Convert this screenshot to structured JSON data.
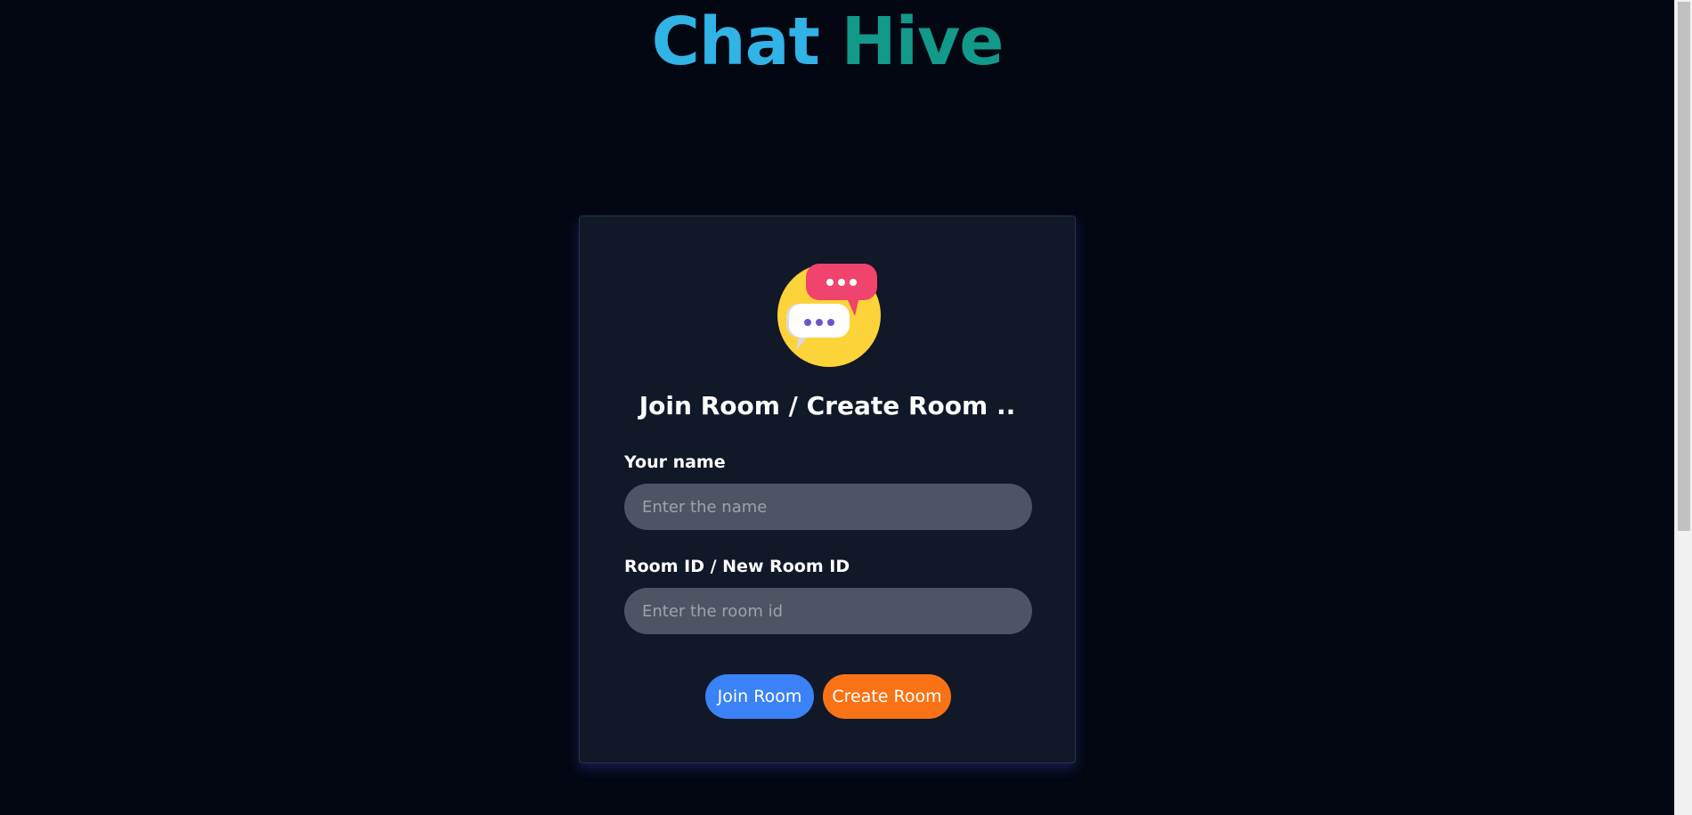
{
  "header": {
    "title_part1": "Chat",
    "title_part2": "Hive"
  },
  "card": {
    "logo_icon": "chat-bubbles-icon",
    "heading": "Join Room / Create Room ..",
    "name_label": "Your name",
    "name_placeholder": "Enter the name",
    "name_value": "",
    "room_label": "Room ID / New Room ID",
    "room_placeholder": "Enter the room id",
    "room_value": "",
    "join_button": "Join Room",
    "create_button": "Create Room"
  },
  "colors": {
    "background": "#030712",
    "card_background": "#111827",
    "input_background": "#4b5563",
    "join_button": "#3b82f6",
    "create_button": "#f97316",
    "title_accent_1": "#31b3e6",
    "title_accent_2": "#12998a"
  }
}
